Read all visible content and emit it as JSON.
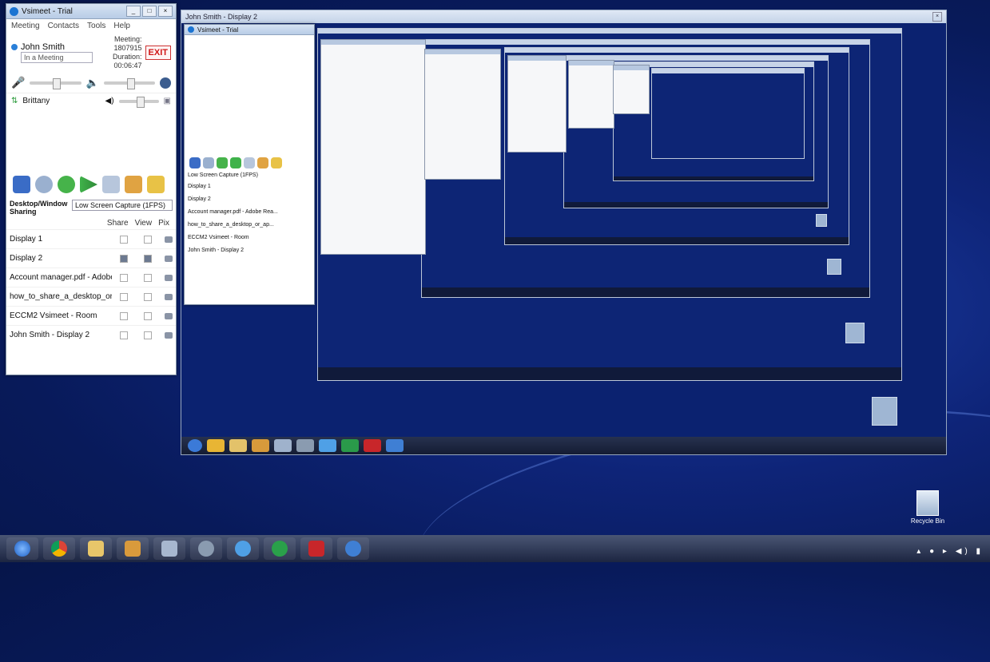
{
  "main_window": {
    "title": "Vsimeet - Trial",
    "menu": [
      "Meeting",
      "Contacts",
      "Tools",
      "Help"
    ],
    "user": {
      "name": "John Smith",
      "status": "In a Meeting"
    },
    "meeting_id_label": "Meeting: 1807915",
    "duration_label": "Duration: 00:06:47",
    "exit_label": "EXIT",
    "participant": "Brittany",
    "sharing_label": "Desktop/Window Sharing",
    "capture_mode": "Low Screen Capture (1FPS)",
    "columns": [
      "Share",
      "View",
      "Pix"
    ],
    "share_items": [
      "Display 1",
      "Display 2",
      "Account manager.pdf - Adobe Rea...",
      "how_to_share_a_desktop_or_ap...",
      "ECCM2 Vsimeet - Room",
      "John Smith - Display 2"
    ]
  },
  "remote_window": {
    "title": "John Smith - Display 2"
  },
  "nested_mini": {
    "title": "Vsimeet - Trial",
    "capture": "Low Screen Capture (1FPS)",
    "items": [
      "Display 1",
      "Display 2",
      "Account manager.pdf - Adobe Rea...",
      "how_to_share_a_desktop_or_ap...",
      "ECCM2 Vsimeet - Room",
      "John Smith - Display 2"
    ]
  },
  "desktop": {
    "recycle_label": "Recycle Bin"
  },
  "taskbar": {
    "apps": [
      "start-orb-icon",
      "chrome-icon",
      "file-explorer-icon",
      "media-icon",
      "word-icon",
      "disk-icon",
      "ie-icon",
      "spotify-icon",
      "acrobat-icon",
      "vsimeet-icon"
    ]
  },
  "colors": {
    "desktop": "#0e2478",
    "exit": "#d01818",
    "accent": "#1b74d2"
  }
}
